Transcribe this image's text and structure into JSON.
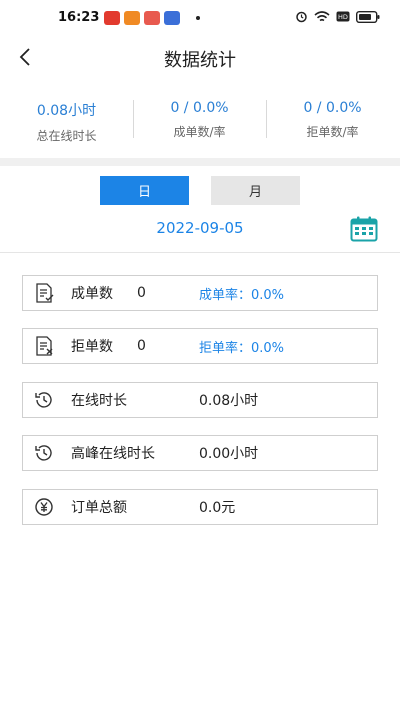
{
  "status_bar": {
    "time": "16:23",
    "icons": [
      "app-icon-1",
      "app-icon-2",
      "app-icon-3",
      "app-icon-4"
    ],
    "right_icons": [
      "alarm-icon",
      "wifi-icon",
      "hd-icon",
      "battery-icon"
    ]
  },
  "header": {
    "title": "数据统计",
    "back_icon": "back-arrow-icon"
  },
  "summary": [
    {
      "value": "0.08小时",
      "label": "总在线时长"
    },
    {
      "value": "0 / 0.0%",
      "label": "成单数/率"
    },
    {
      "value": "0 / 0.0%",
      "label": "拒单数/率"
    }
  ],
  "tabs": {
    "day": "日",
    "month": "月",
    "active": "day"
  },
  "date": "2022-09-05",
  "colors": {
    "accent": "#1c84e6",
    "icon_teal": "#1aa3a8"
  },
  "cards": {
    "completed": {
      "label": "成单数",
      "value": "0",
      "rate": "成单率：0.0%"
    },
    "rejected": {
      "label": "拒单数",
      "value": "0",
      "rate": "拒单率：0.0%"
    },
    "online": {
      "label": "在线时长",
      "value": "0.08小时"
    },
    "peak": {
      "label": "高峰在线时长",
      "value": "0.00小时"
    },
    "amount": {
      "label": "订单总额",
      "value": "0.0元"
    }
  }
}
